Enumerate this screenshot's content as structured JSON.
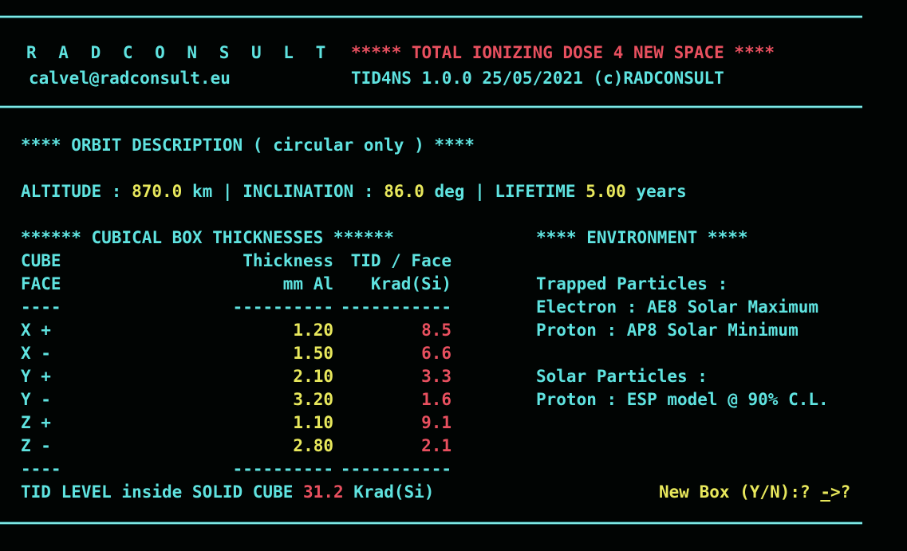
{
  "app": {
    "brand": "R A D C O N S U L T",
    "email": "calvel@radconsult.eu",
    "title": "***** TOTAL IONIZING DOSE 4 NEW SPACE ****",
    "program": "TID4NS",
    "version": "1.0.0",
    "date": "25/05/2021",
    "copyright": "(c)RADCONSULT",
    "version_line": "TID4NS  1.0.0    25/05/2021  (c)RADCONSULT"
  },
  "orbit": {
    "section_title": "**** ORBIT DESCRIPTION ( circular only ) ****",
    "altitude_label": "ALTITUDE :",
    "altitude_value": "870.0",
    "altitude_unit": "km",
    "sep1": "|",
    "inclination_label": "INCLINATION :",
    "inclination_value": "86.0",
    "inclination_unit": "deg",
    "sep2": "|",
    "lifetime_label": "LIFETIME",
    "lifetime_value": "5.00",
    "lifetime_unit": "years"
  },
  "box": {
    "section_title": "****** CUBICAL BOX THICKNESSES ******",
    "headers": {
      "face_line1": "CUBE",
      "face_line2": "FACE",
      "thickness_line1": "Thickness",
      "thickness_line2": "mm Al",
      "tid_line1": "TID / Face",
      "tid_line2": "Krad(Si)"
    },
    "rule_face": "----",
    "rule_thickness": "----------",
    "rule_tid": "-----------",
    "rows": [
      {
        "face": "X +",
        "thickness": "1.20",
        "tid": "8.5"
      },
      {
        "face": "X -",
        "thickness": "1.50",
        "tid": "6.6"
      },
      {
        "face": "Y +",
        "thickness": "2.10",
        "tid": "3.3"
      },
      {
        "face": "Y -",
        "thickness": "3.20",
        "tid": "1.6"
      },
      {
        "face": "Z +",
        "thickness": "1.10",
        "tid": "9.1"
      },
      {
        "face": "Z -",
        "thickness": "2.80",
        "tid": "2.1"
      }
    ]
  },
  "environment": {
    "section_title": "**** ENVIRONMENT ****",
    "trapped_label": "Trapped Particles :",
    "trapped_electron": "Electron : AE8 Solar Maximum",
    "trapped_proton": "Proton : AP8 Solar Minimum",
    "solar_label": "Solar Particles :",
    "solar_proton": "Proton : ESP model @ 90% C.L."
  },
  "footer": {
    "tid_label": "TID LEVEL inside SOLID CUBE",
    "tid_value": "31.2",
    "tid_unit": "Krad(Si)",
    "prompt_label": "New Box (Y/N):?",
    "prompt_cursor": "-",
    "prompt_tail": ">?"
  },
  "colors": {
    "background": "#010403",
    "cyan": "#5fe3e0",
    "yellow": "#e8e85c",
    "red": "#e8505f",
    "rule": "#7fe9e6"
  }
}
